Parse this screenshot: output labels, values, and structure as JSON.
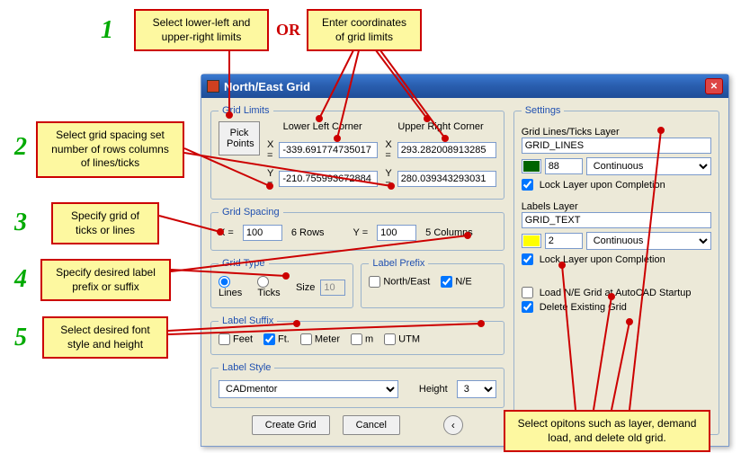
{
  "callouts": {
    "c1a": "Select lower-left and upper-right limits",
    "or": "OR",
    "c1b": "Enter coordinates of grid limits",
    "c2": "Select grid spacing set number of rows columns of lines/ticks",
    "c3": "Specify grid of ticks or lines",
    "c4": "Specify desired label prefix or suffix",
    "c5": "Select desired font style and height",
    "c6": "Select opitons such as layer, demand load, and delete old grid."
  },
  "steps": {
    "s1": "1",
    "s2": "2",
    "s3": "3",
    "s4": "4",
    "s5": "5"
  },
  "dialog": {
    "title": "North/East Grid",
    "grid_limits": {
      "legend": "Grid Limits",
      "pick_btn": "Pick Points",
      "ll_header": "Lower Left Corner",
      "ur_header": "Upper Right Corner",
      "x_label": "X =",
      "y_label": "Y =",
      "ll_x": "-339.691774735017",
      "ll_y": "-210.755993672884",
      "ur_x": "293.282008913285",
      "ur_y": "280.039343293031"
    },
    "grid_spacing": {
      "legend": "Grid Spacing",
      "x_label": "X =",
      "x_val": "100",
      "rows_text": "6 Rows",
      "y_label": "Y =",
      "y_val": "100",
      "cols_text": "5 Columns"
    },
    "grid_type": {
      "legend": "Grid Type",
      "lines": "Lines",
      "ticks": "Ticks",
      "size_label": "Size",
      "size_val": "10"
    },
    "label_prefix": {
      "legend": "Label Prefix",
      "ne": "North/East",
      "short": "N/E"
    },
    "label_suffix": {
      "legend": "Label Suffix",
      "feet": "Feet",
      "ft": "Ft.",
      "meter": "Meter",
      "m": "m",
      "utm": "UTM"
    },
    "label_style": {
      "legend": "Label Style",
      "font": "CADmentor",
      "height_label": "Height",
      "height_val": "3"
    },
    "buttons": {
      "create": "Create Grid",
      "cancel": "Cancel",
      "back": "‹"
    },
    "settings": {
      "legend": "Settings",
      "grid_layer_label": "Grid Lines/Ticks Layer",
      "grid_layer": "GRID_LINES",
      "grid_color": "88",
      "grid_linetype": "Continuous",
      "grid_lock": "Lock Layer upon Completion",
      "labels_layer_label": "Labels Layer",
      "labels_layer": "GRID_TEXT",
      "labels_color": "2",
      "labels_linetype": "Continuous",
      "labels_lock": "Lock Layer upon Completion",
      "load_startup": "Load N/E Grid at AutoCAD Startup",
      "delete_existing": "Delete Existing Grid"
    }
  }
}
